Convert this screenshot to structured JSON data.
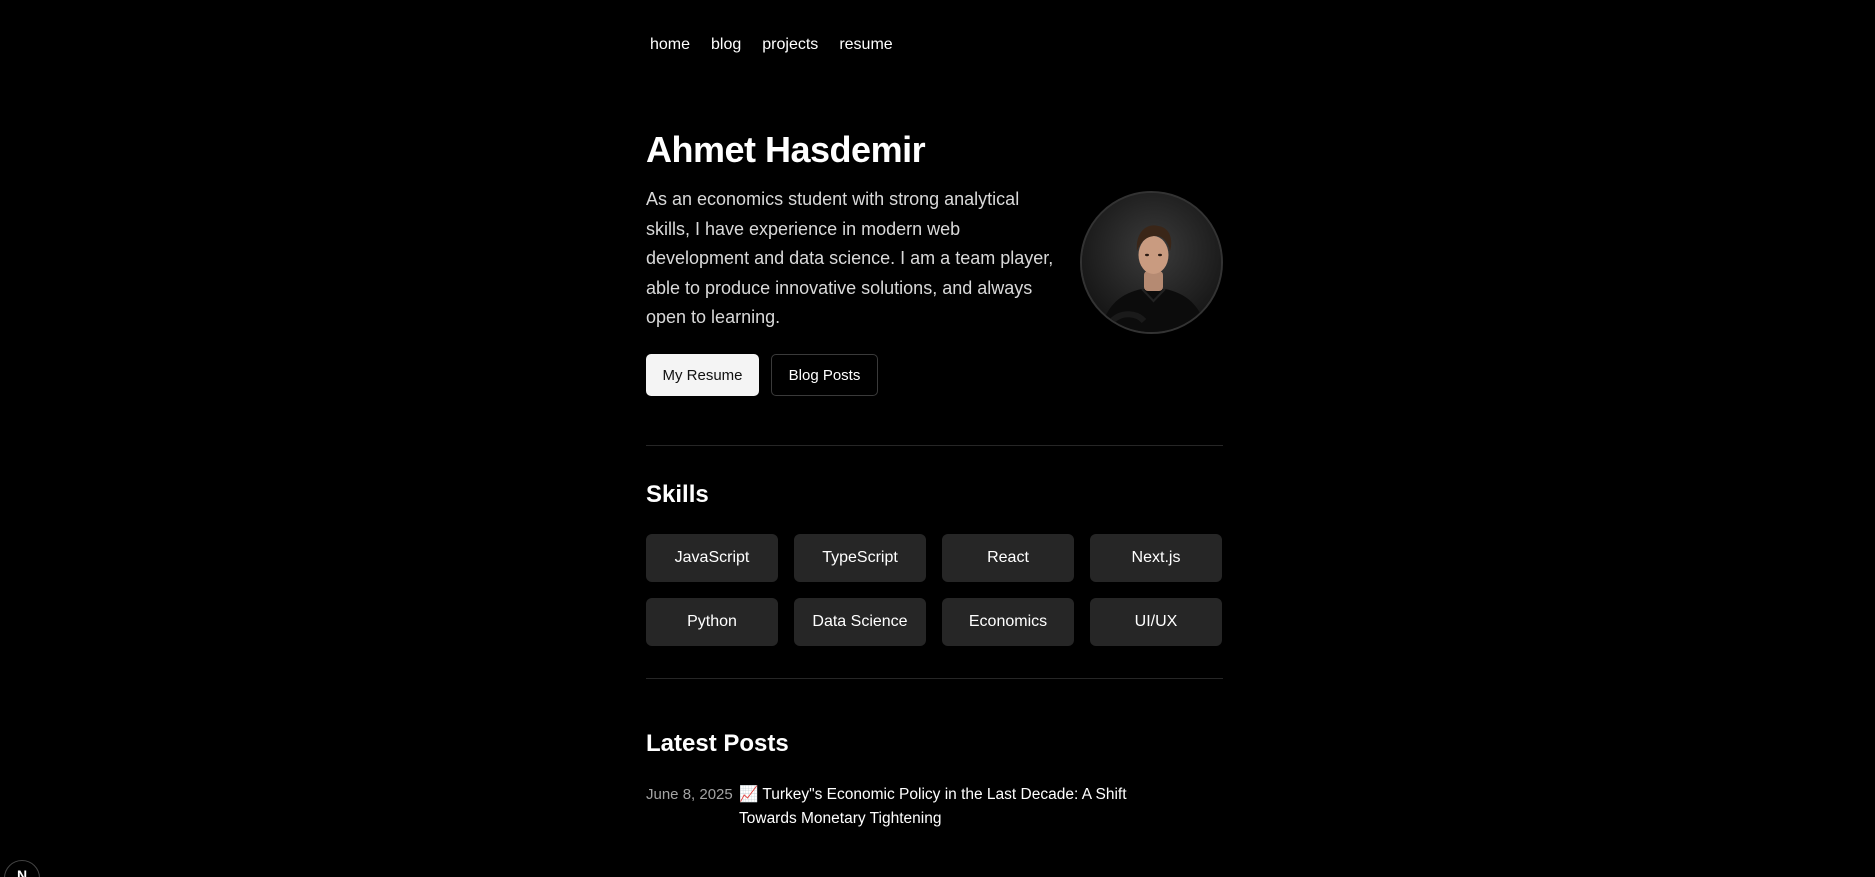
{
  "nav": {
    "items": [
      "home",
      "blog",
      "projects",
      "resume"
    ]
  },
  "hero": {
    "name": "Ahmet Hasdemir",
    "description": "As an economics student with strong analytical skills, I have experience in modern web development and data science. I am a team player, able to produce innovative solutions, and always open to learning.",
    "primary_button": "My Resume",
    "secondary_button": "Blog Posts"
  },
  "skills": {
    "title": "Skills",
    "items": [
      "JavaScript",
      "TypeScript",
      "React",
      "Next.js",
      "Python",
      "Data Science",
      "Economics",
      "UI/UX"
    ]
  },
  "latest_posts": {
    "title": "Latest Posts",
    "items": [
      {
        "date": "June 8, 2025",
        "title": "📈 Turkey\"s Economic Policy in the Last Decade: A Shift Towards Monetary Tightening"
      }
    ]
  },
  "corner_badge": {
    "label": "N"
  },
  "colors": {
    "background": "#000000",
    "chip_background": "#262626",
    "divider": "#262626",
    "muted_text": "#a3a3a3"
  },
  "icons": {
    "avatar": "profile-photo",
    "corner": "nextjs-logo-icon"
  }
}
